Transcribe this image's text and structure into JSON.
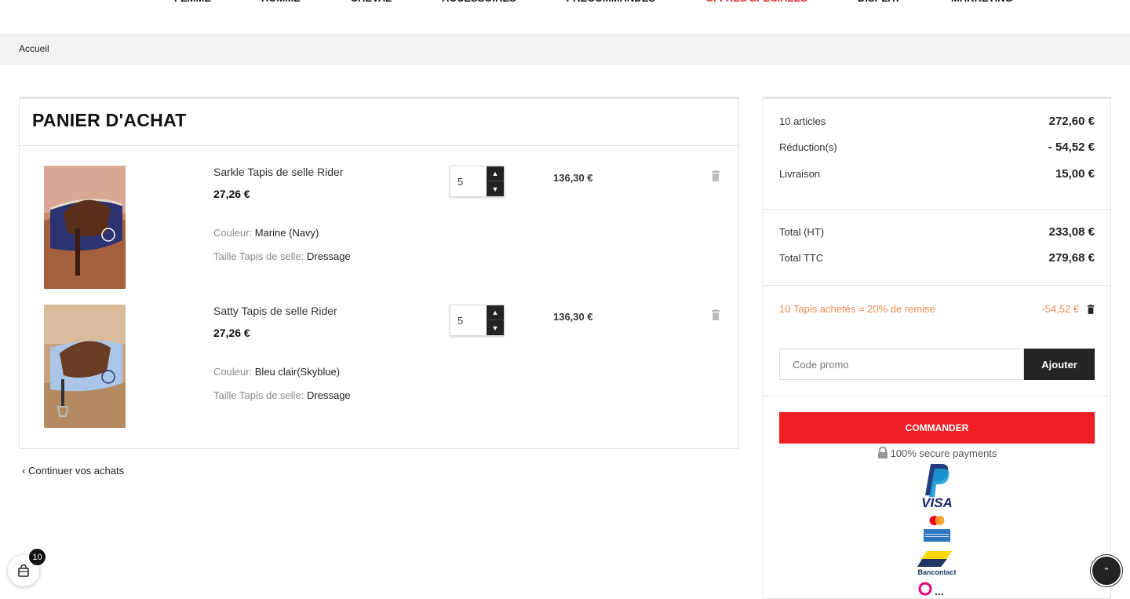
{
  "nav": {
    "items": [
      {
        "label": "FEMME",
        "special": false
      },
      {
        "label": "HOMME",
        "special": false
      },
      {
        "label": "CHEVAL",
        "special": false
      },
      {
        "label": "ACCESSOIRES",
        "special": false
      },
      {
        "label": "PRÉCOMMANDES",
        "special": false
      },
      {
        "label": "OFFRES SPÉCIALES",
        "special": true
      },
      {
        "label": "DISPLAY",
        "special": false
      },
      {
        "label": "MARKETING",
        "special": false
      }
    ]
  },
  "breadcrumb": {
    "home": "Accueil"
  },
  "cart": {
    "title": "PANIER D'ACHAT",
    "items": [
      {
        "name": "Sarkle Tapis de selle Rider",
        "price": "27,26 €",
        "color_label": "Couleur:",
        "color_value": "Marine (Navy)",
        "size_label": "Taille Tapis de selle:",
        "size_value": "Dressage",
        "quantity": "5",
        "total": "136,30 €",
        "pad_color": "#2b3470"
      },
      {
        "name": "Satty Tapis de selle Rider",
        "price": "27,26 €",
        "color_label": "Couleur:",
        "color_value": "Bleu clair(Skyblue)",
        "size_label": "Taille Tapis de selle:",
        "size_value": "Dressage",
        "quantity": "5",
        "total": "136,30 €",
        "pad_color": "#a9c6e8"
      }
    ],
    "continue_label": "Continuer vos achats"
  },
  "summary": {
    "articles_label": "10 articles",
    "articles_value": "272,60 €",
    "reduction_label": "Réduction(s)",
    "reduction_value": "- 54,52 €",
    "delivery_label": "Livraison",
    "delivery_value": "15,00 €",
    "total_ht_label": "Total (HT)",
    "total_ht_value": "233,08 €",
    "total_ttc_label": "Total TTC",
    "total_ttc_value": "279,68 €",
    "promo_applied_label": "10 Tapis achetés = 20% de remise",
    "promo_applied_value": "-54,52 €",
    "promo_placeholder": "Code promo",
    "promo_button": "Ajouter",
    "order_button": "COMMANDER",
    "secure_text": "100% secure payments",
    "payment_logos": [
      "PayPal",
      "VISA",
      "Mastercard",
      "American Express",
      "Bancontact"
    ]
  },
  "floating_cart": {
    "count": "10"
  },
  "colors": {
    "accent_red": "#ee1e24",
    "promo_orange": "#f08a50",
    "dark": "#232323"
  }
}
